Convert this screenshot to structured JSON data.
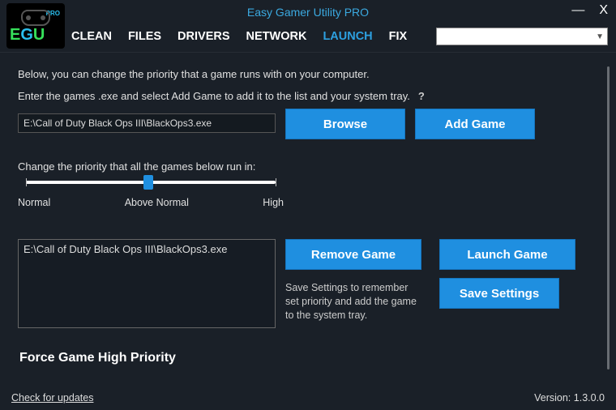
{
  "window": {
    "title": "Easy Gamer Utility PRO",
    "logo": {
      "letters": [
        "E",
        "G",
        "U"
      ],
      "pro": "PRO"
    },
    "min_icon": "—",
    "close_icon": "X"
  },
  "tabs": [
    "CLEAN",
    "FILES",
    "DRIVERS",
    "NETWORK",
    "LAUNCH",
    "FIX"
  ],
  "active_tab_index": 4,
  "dropdown": {
    "selected": ""
  },
  "launch": {
    "intro": "Below, you can change the priority that a game runs with on your computer.",
    "instruction": "Enter the games .exe and select Add Game to add it to the list and your system tray.",
    "help_icon": "?",
    "path_value": "E:\\Call of Duty Black Ops III\\BlackOps3.exe",
    "browse_label": "Browse",
    "addgame_label": "Add Game",
    "slider": {
      "label": "Change the priority that all the games below run in:",
      "marks": [
        "Normal",
        "Above Normal",
        "High"
      ],
      "value_index": 1
    },
    "games": [
      "E:\\Call of Duty Black Ops III\\BlackOps3.exe"
    ],
    "remove_label": "Remove Game",
    "launchgame_label": "Launch Game",
    "save_hint": "Save Settings to remember set priority and add the game to the system tray.",
    "save_label": "Save Settings",
    "force_title": "Force Game High Priority"
  },
  "footer": {
    "updates_link": "Check for updates",
    "version_label": "Version:",
    "version_value": "1.3.0.0"
  }
}
